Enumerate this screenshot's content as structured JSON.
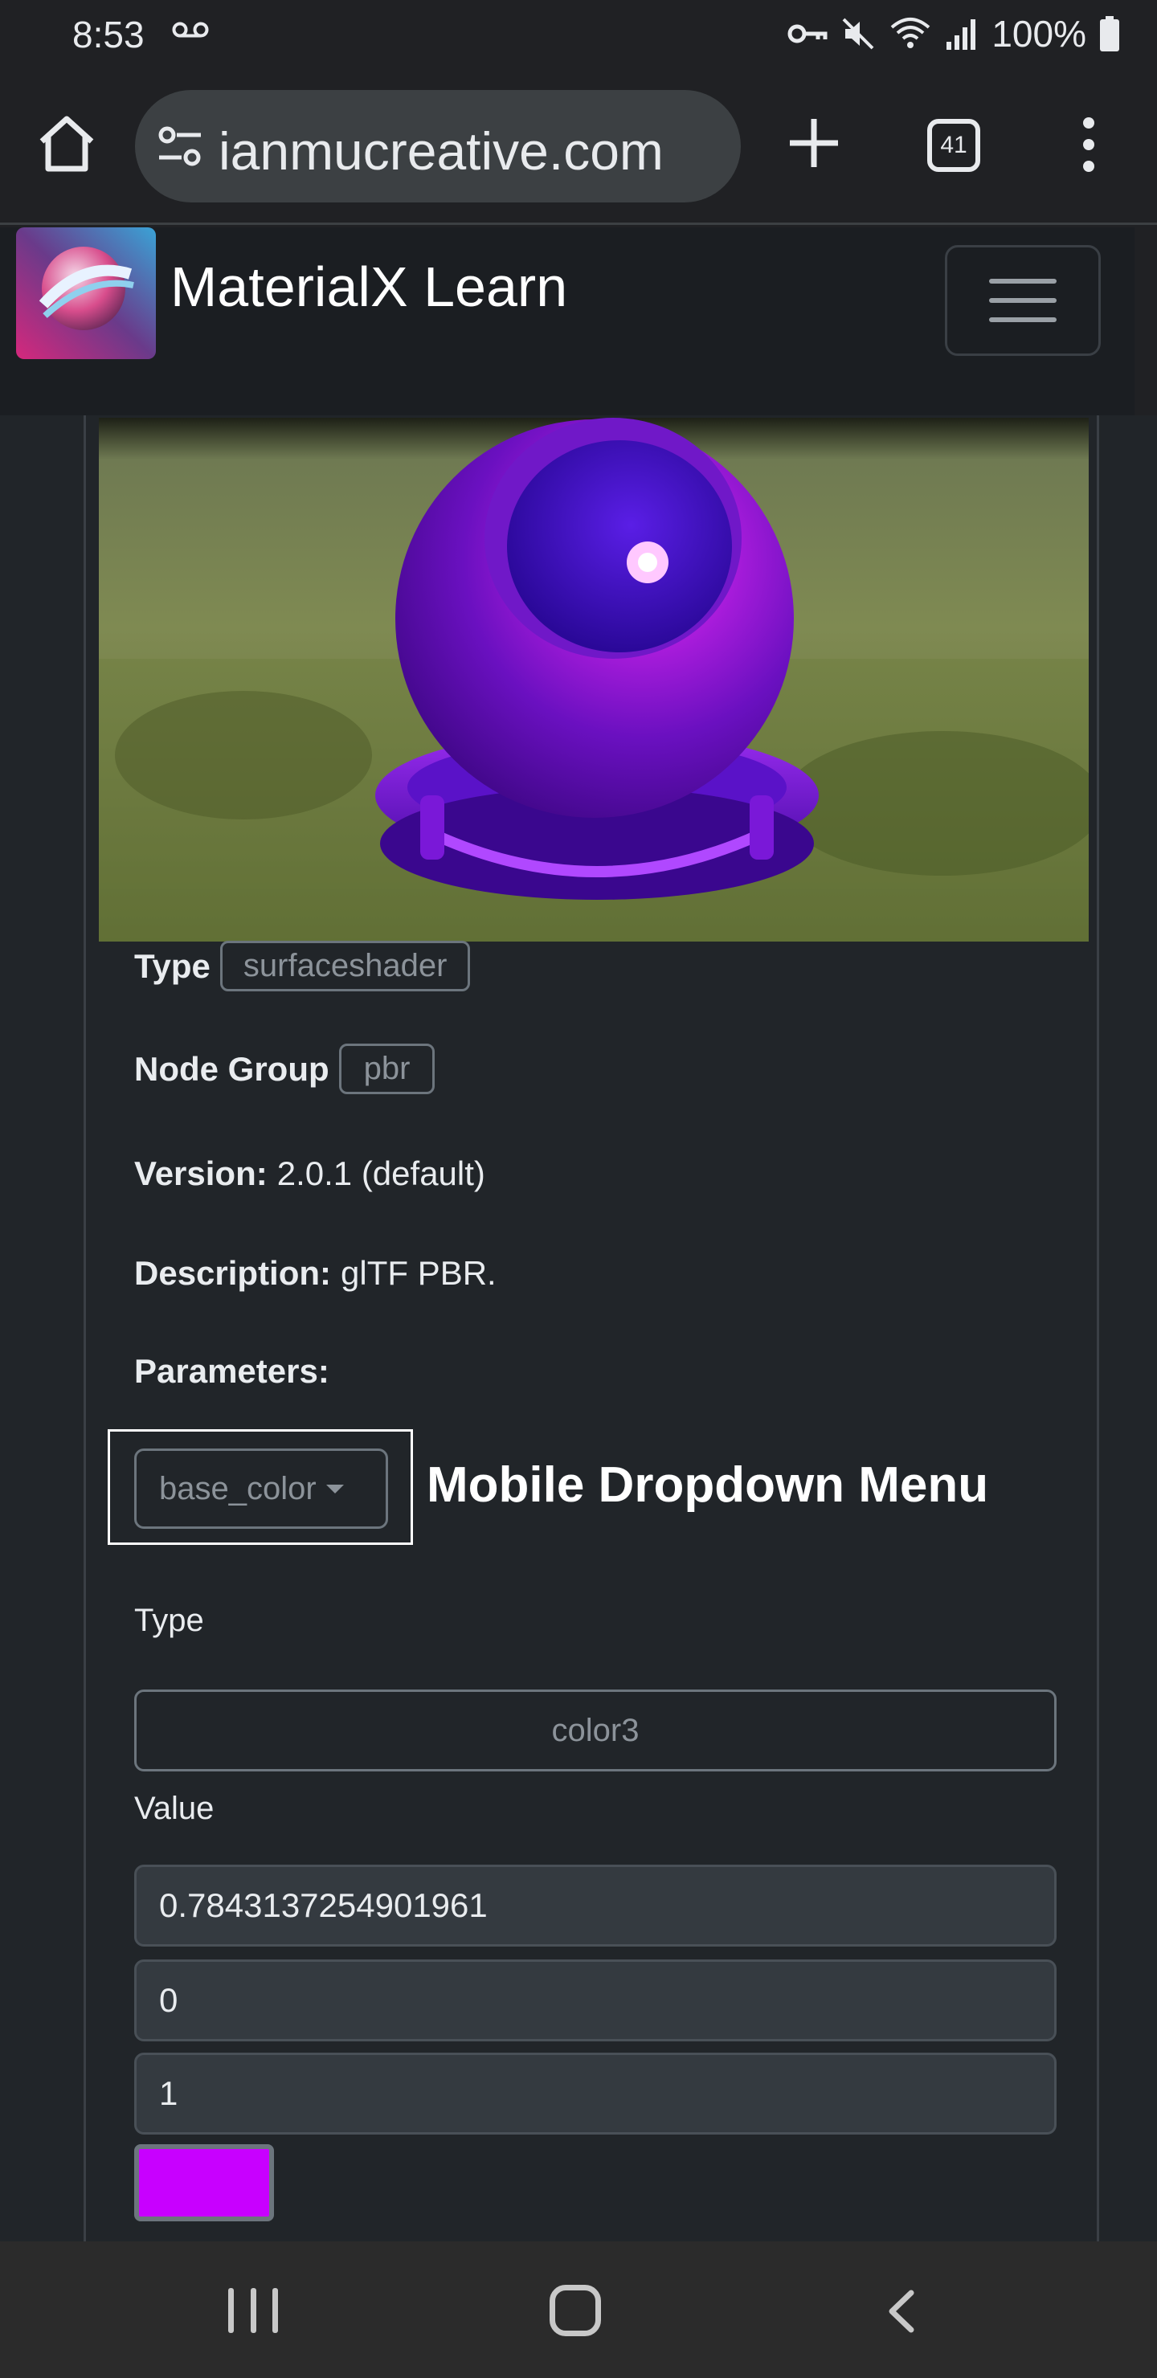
{
  "status_bar": {
    "time": "8:53",
    "battery": "100%"
  },
  "browser": {
    "url": "ianmucreative.com",
    "tab_count": "41"
  },
  "site": {
    "title": "MaterialX Learn"
  },
  "node": {
    "type_label": "Type",
    "type_value": "surfaceshader",
    "group_label": "Node Group",
    "group_value": "pbr",
    "version_label": "Version:",
    "version_value": "2.0.1 (default)",
    "description_label": "Description:",
    "description_value": "glTF PBR.",
    "parameters_label": "Parameters:"
  },
  "parameter": {
    "selected": "base_color",
    "dropdown_heading": "Mobile Dropdown Menu",
    "type_label": "Type",
    "type_value": "color3",
    "value_label": "Value",
    "values": [
      "0.7843137254901961",
      "0",
      "1"
    ],
    "swatch_color": "#c800ff"
  },
  "icons": {
    "home": "home-icon",
    "site_info": "tune-icon",
    "new_tab": "plus-icon",
    "tabs": "tab-switcher-icon",
    "menu": "more-vert-icon",
    "hamburger": "hamburger-icon"
  }
}
